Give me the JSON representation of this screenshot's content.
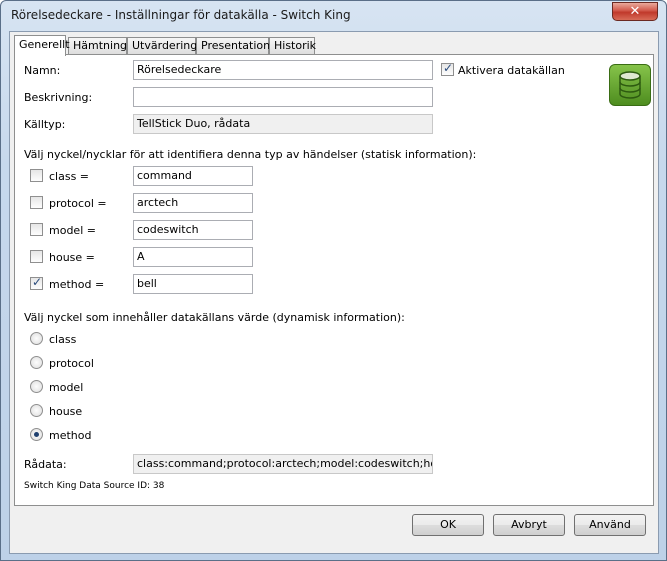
{
  "window": {
    "title": "Rörelsedeckare - Inställningar för datakälla - Switch King",
    "close_symbol": "✕"
  },
  "tabs": [
    {
      "label": "Generellt",
      "active": true
    },
    {
      "label": "Hämtning",
      "active": false
    },
    {
      "label": "Utvärdering",
      "active": false
    },
    {
      "label": "Presentation",
      "active": false
    },
    {
      "label": "Historik",
      "active": false
    }
  ],
  "general": {
    "name_label": "Namn:",
    "name_value": "Rörelsedeckare",
    "activate_label": "Aktivera datakällan",
    "activate_checked": true,
    "description_label": "Beskrivning:",
    "description_value": "",
    "source_type_label": "Källtyp:",
    "source_type_value": "TellStick Duo, rådata",
    "icon": "database-icon"
  },
  "static_keys": {
    "heading": "Välj nyckel/nycklar för att identifiera denna typ av händelser (statisk information):",
    "items": [
      {
        "label": "class =",
        "value": "command",
        "checked": false
      },
      {
        "label": "protocol =",
        "value": "arctech",
        "checked": false
      },
      {
        "label": "model =",
        "value": "codeswitch",
        "checked": false
      },
      {
        "label": "house =",
        "value": "A",
        "checked": false
      },
      {
        "label": "method =",
        "value": "bell",
        "checked": true
      }
    ]
  },
  "dynamic_key": {
    "heading": "Välj nyckel som innehåller datakällans värde (dynamisk information):",
    "options": [
      {
        "label": "class",
        "selected": false
      },
      {
        "label": "protocol",
        "selected": false
      },
      {
        "label": "model",
        "selected": false
      },
      {
        "label": "house",
        "selected": false
      },
      {
        "label": "method",
        "selected": true
      }
    ]
  },
  "raw": {
    "label": "Rådata:",
    "value": "class:command;protocol:arctech;model:codeswitch;house:A;r"
  },
  "footer_id": "Switch King Data Source ID: 38",
  "buttons": {
    "ok": "OK",
    "cancel": "Avbryt",
    "apply": "Använd"
  },
  "check_mark": "✓"
}
